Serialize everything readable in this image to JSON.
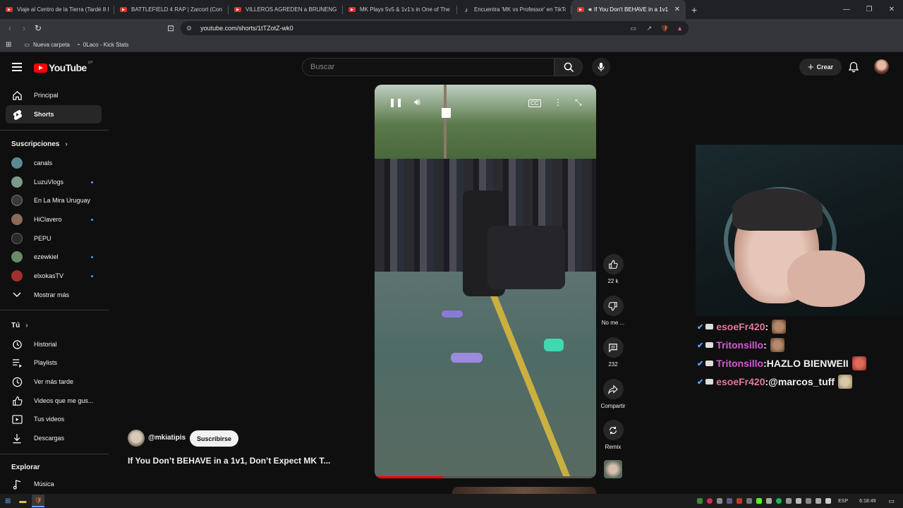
{
  "browser": {
    "tabs": [
      {
        "title": "Viaje al Centro de la Tierra (Tardé 8 D",
        "active": false
      },
      {
        "title": "BATTLEFIELD 4 RAP | Zarcort (Con Pi",
        "active": false
      },
      {
        "title": "VILLEROS AGREDEN a BRUNENGER y",
        "active": false
      },
      {
        "title": "MK Plays 5v5 & 1v1's in One of The M",
        "active": false
      },
      {
        "title": "Encuentra 'MK vs Professor' en TikTo",
        "active": false
      },
      {
        "title": "If You Don't BEHAVE in a 1v1",
        "active": true
      }
    ],
    "url": "youtube.com/shorts/1tTZotZ-wk0",
    "bookmarks": [
      "Nueva carpeta",
      "0Laco - Kick Stats"
    ]
  },
  "youtube": {
    "logo": "YouTube",
    "region": "UY",
    "search_placeholder": "Buscar",
    "create_label": "Crear",
    "sidebar": {
      "main": [
        {
          "label": "Principal",
          "icon": "home-icon"
        },
        {
          "label": "Shorts",
          "icon": "shorts-icon",
          "selected": true
        }
      ],
      "subscriptions_title": "Suscripciones",
      "subscriptions": [
        {
          "label": "canals",
          "dot": false,
          "color": "#5a8a96"
        },
        {
          "label": "LuzuVlogs",
          "dot": true,
          "color": "#7a9a8a"
        },
        {
          "label": "En La Mira Uruguay",
          "dot": false,
          "color": "#3a3a3a"
        },
        {
          "label": "HiClavero",
          "dot": true,
          "color": "#8a6a5a"
        },
        {
          "label": "PEPU",
          "dot": false,
          "color": "#2a2a2a"
        },
        {
          "label": "ezewkiel",
          "dot": true,
          "color": "#6a8a6a"
        },
        {
          "label": "elxokasTV",
          "dot": true,
          "color": "#a03030"
        }
      ],
      "show_more": "Mostrar más",
      "you_title": "Tú",
      "you_items": [
        {
          "label": "Historial",
          "icon": "history-icon"
        },
        {
          "label": "Playlists",
          "icon": "playlist-icon"
        },
        {
          "label": "Ver más tarde",
          "icon": "clock-icon"
        },
        {
          "label": "Videos que me gus...",
          "icon": "thumbs-up-icon"
        },
        {
          "label": "Tus videos",
          "icon": "video-icon"
        },
        {
          "label": "Descargas",
          "icon": "download-icon"
        }
      ],
      "explore_title": "Explorar",
      "explore_items": [
        {
          "label": "Música",
          "icon": "music-icon"
        }
      ]
    },
    "short": {
      "channel": "@mkiatipis",
      "subscribe": "Suscribirse",
      "title": "If You Don’t BEHAVE in a 1v1, Don’t Expect MK T...",
      "progress": 0.31,
      "actions": [
        {
          "label": "22 k",
          "icon": "like-icon"
        },
        {
          "label": "No me ...",
          "icon": "dislike-icon"
        },
        {
          "label": "232",
          "icon": "comment-icon"
        },
        {
          "label": "Compartir",
          "icon": "share-icon"
        },
        {
          "label": "Remix",
          "icon": "remix-icon"
        }
      ]
    }
  },
  "stream_chat": [
    {
      "user": "esoeFr420",
      "text": "",
      "color": "#e07a9a"
    },
    {
      "user": "Tritonsillo",
      "text": "",
      "color": "#d65ad6"
    },
    {
      "user": "Tritonsillo",
      "text": " HAZLO BIENWEII",
      "color": "#d65ad6"
    },
    {
      "user": "esoeFr420",
      "text": " @marcos_tuff",
      "color": "#e07a9a"
    }
  ],
  "taskbar": {
    "lang": "ESP",
    "time": "6:18:49"
  }
}
